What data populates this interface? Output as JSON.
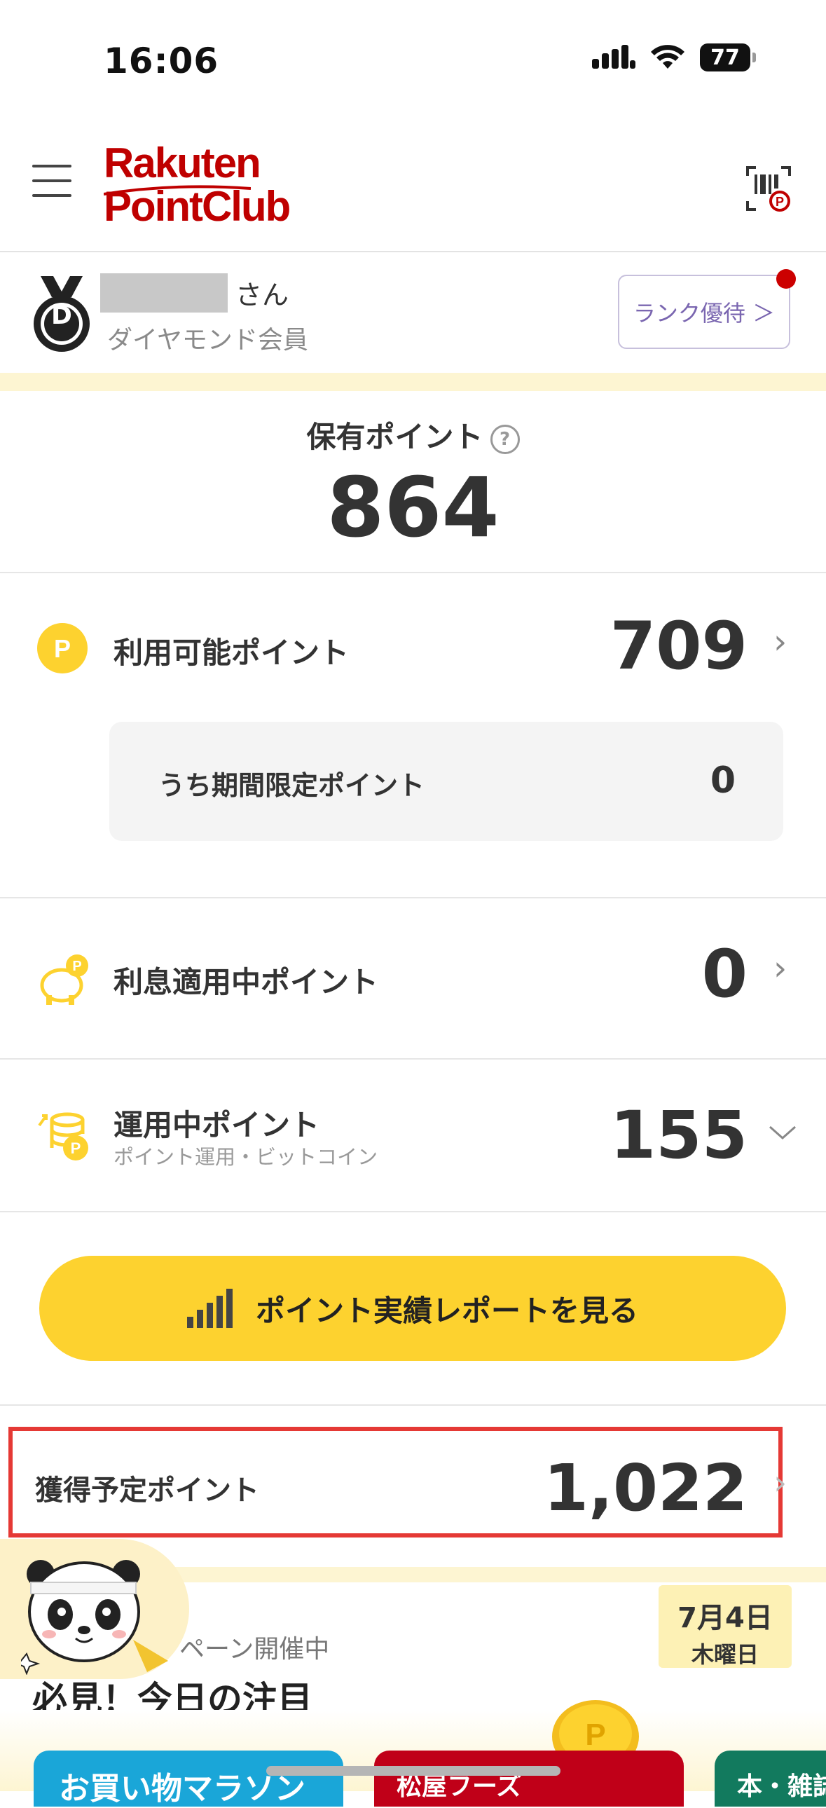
{
  "status_bar": {
    "time": "16:06",
    "battery": "77"
  },
  "header": {
    "logo_line1": "Rakuten",
    "logo_line2": "PointClub"
  },
  "member": {
    "honorific": "さん",
    "rank": "ダイヤモンド会員",
    "badge_letter": "D",
    "rank_benefits_label": "ランク優待 ＞"
  },
  "held_points": {
    "label": "保有ポイント",
    "help": "?",
    "value": "864"
  },
  "available": {
    "label": "利用可能ポイント",
    "value": "709",
    "limited_label": "うち期間限定ポイント",
    "limited_value": "0"
  },
  "interest": {
    "label": "利息適用中ポイント",
    "value": "0"
  },
  "investing": {
    "label": "運用中ポイント",
    "sublabel": "ポイント運用・ビットコイン",
    "value": "155"
  },
  "report_button": {
    "label": "ポイント実績レポートを見る"
  },
  "pending": {
    "label": "獲得予定ポイント",
    "value": "1,022"
  },
  "promo": {
    "date": "7月4日",
    "weekday": "木曜日",
    "campaign_text": "ペーン開催中",
    "title": "必見！今日の注目",
    "banners": [
      "お買い物マラソン",
      "松屋フーズ",
      "本・雑誌"
    ]
  },
  "colors": {
    "brand_red": "#bf0000",
    "yellow": "#fdd22f",
    "highlight_red": "#e53935",
    "purple": "#7a66b0"
  }
}
